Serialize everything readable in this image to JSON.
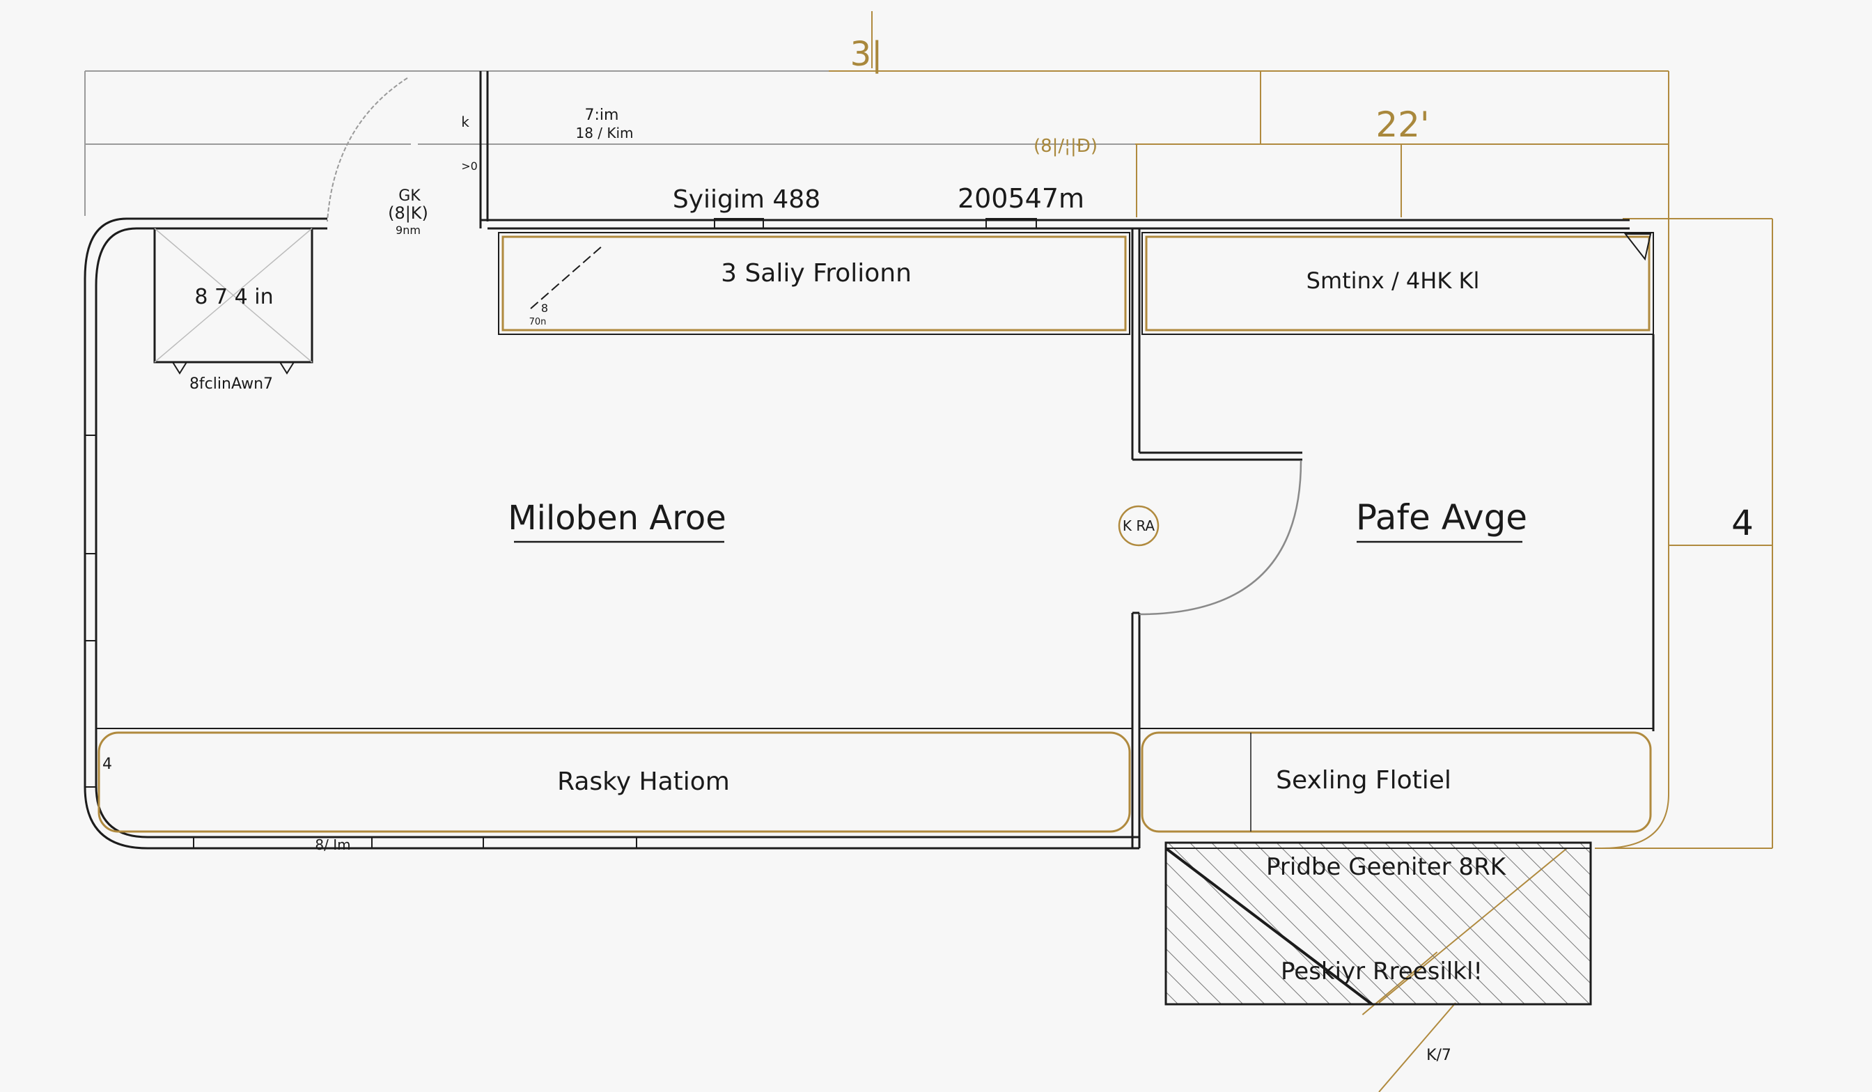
{
  "dimensions": {
    "top": "3|",
    "right_upper": "22'",
    "right_side": "4",
    "mid_gold": "(8|/¦|Đ)",
    "top_small_1": "7:im",
    "top_small_2": "18 / Kim",
    "gk_1": "GK",
    "gk_2": "(8|K)",
    "gk_3": "9nm",
    "bottom_small": "8/ Im",
    "side_small_1": "k",
    "side_small_2": ">0",
    "corner_small": "4",
    "diag_small_1": "8",
    "diag_small_2": "70n",
    "bottom_leader": "K/7"
  },
  "labels": {
    "window_left": "Syiigim 488",
    "window_right": "200547m",
    "closet": "8 7 4 in",
    "closet_sub": "8fclinAwn7",
    "counter_top_left": "3 Saliy Frolionn",
    "counter_top_right": "Smtinx / 4HK  Kl",
    "room_left": "Miloben Aroe",
    "room_right": "Pafe Avge",
    "center_marker": "K RA",
    "counter_bottom_left": "Rasky Hatiom",
    "counter_bottom_right": "Sexling Flotiel",
    "hatch_top": "Pridbe Geeniter 8RK",
    "hatch_bottom": "Peskiyr Rreesilkl!"
  },
  "colors": {
    "accent_gold": "#b08a3e",
    "wall": "#1c1c1c",
    "guide_grey": "#9a9a9a"
  }
}
